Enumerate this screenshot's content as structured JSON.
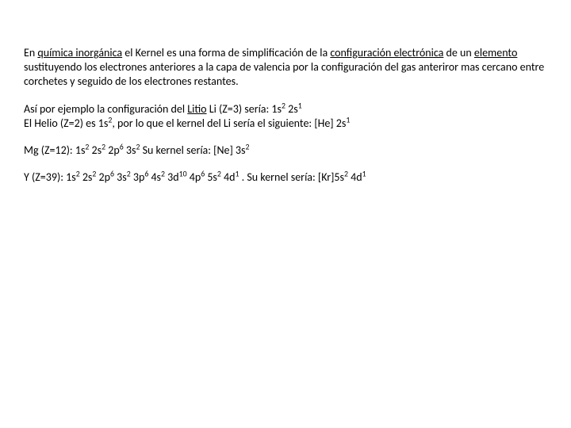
{
  "p1": {
    "t1": "En ",
    "link1": "química inorgánica",
    "t2": " el Kernel es una forma de simplificación de la ",
    "link2": "configuración electrónica",
    "t3": " de un ",
    "link3": "elemento",
    "t4": " sustituyendo los electrones anteriores a la capa de valencia por la configuración del gas anteriror mas cercano entre corchetes y seguido de los electrones restantes."
  },
  "p2": {
    "t1": "Así por ejemplo la configuración del ",
    "link1": "Litio",
    "t2": "   Li (Z=3) sería:  1s",
    "sup1": "2",
    "t3": " 2s",
    "sup2": "1",
    "br1_t1": "El Helio (Z=2) es 1s",
    "br1_sup1": "2",
    "br1_t2": ", por lo que el kernel del Li sería el siguiente: [He] 2s",
    "br1_sup2": "1"
  },
  "p3": {
    "t1": "Mg (Z=12):   1s",
    "sup1": "2",
    "t2": " 2s",
    "sup2": "2",
    "t3": " 2p",
    "sup3": "6",
    "t4": " 3s",
    "sup4": "2",
    "t5": "     Su kernel sería: [Ne] 3s",
    "sup5": "2"
  },
  "p4": {
    "t1": "Y (Z=39):   1s",
    "sup1": "2",
    "t2": " 2s",
    "sup2": "2",
    "t3": " 2p",
    "sup3": "6",
    "t4": " 3s",
    "sup4": "2",
    "t5": " 3p",
    "sup5": "6",
    "t6": " 4s",
    "sup6": "2",
    "t7": " 3d",
    "sup7": "10",
    "t8": " 4p",
    "sup8": "6",
    "t9": " 5s",
    "sup9": "2",
    "t10": " 4d",
    "sup10": "1",
    "t11": "   . Su kernel sería: [Kr]5s",
    "sup11": "2",
    "t12": " 4d",
    "sup12": "1"
  }
}
